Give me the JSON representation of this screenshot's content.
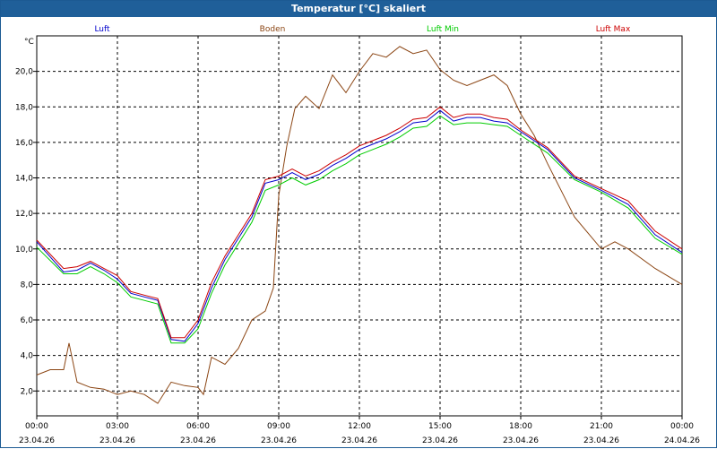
{
  "window": {
    "title": "Temperatur [°C] skaliert"
  },
  "chart_data": {
    "type": "line",
    "title": "Temperatur [°C] skaliert",
    "ylabel": "°C",
    "xlabel": "",
    "ylim": [
      0.6,
      22.0
    ],
    "xlim": [
      0,
      24
    ],
    "grid": true,
    "legend_position": "top",
    "y_ticks": [
      "2,0",
      "4,0",
      "6,0",
      "8,0",
      "10,0",
      "12,0",
      "14,0",
      "16,0",
      "18,0",
      "20,0"
    ],
    "y_tick_values": [
      2,
      4,
      6,
      8,
      10,
      12,
      14,
      16,
      18,
      20
    ],
    "x_ticks": [
      {
        "time": "00:00",
        "date": "23.04.26"
      },
      {
        "time": "03:00",
        "date": "23.04.26"
      },
      {
        "time": "06:00",
        "date": "23.04.26"
      },
      {
        "time": "09:00",
        "date": "23.04.26"
      },
      {
        "time": "12:00",
        "date": "23.04.26"
      },
      {
        "time": "15:00",
        "date": "23.04.26"
      },
      {
        "time": "18:00",
        "date": "23.04.26"
      },
      {
        "time": "21:00",
        "date": "23.04.26"
      },
      {
        "time": "00:00",
        "date": "24.04.26"
      }
    ],
    "series": [
      {
        "name": "Luft",
        "color": "#0000cc",
        "x": [
          0,
          1,
          1.5,
          2,
          2.5,
          3,
          3.5,
          4,
          4.5,
          5,
          5.5,
          6,
          6.5,
          7,
          7.5,
          8,
          8.5,
          9,
          9.5,
          10,
          10.5,
          11,
          11.5,
          12,
          12.5,
          13,
          13.5,
          14,
          14.5,
          15,
          15.5,
          16,
          16.5,
          17,
          17.5,
          18,
          19,
          20,
          21,
          22,
          23,
          24
        ],
        "y": [
          10.4,
          8.7,
          8.8,
          9.2,
          8.8,
          8.3,
          7.5,
          7.3,
          7.1,
          4.9,
          4.8,
          5.8,
          7.8,
          9.4,
          10.6,
          11.8,
          13.7,
          13.9,
          14.3,
          13.9,
          14.2,
          14.7,
          15.1,
          15.6,
          15.9,
          16.2,
          16.6,
          17.1,
          17.2,
          17.8,
          17.2,
          17.4,
          17.4,
          17.2,
          17.1,
          16.6,
          15.6,
          14.0,
          13.3,
          12.5,
          10.8,
          9.8
        ]
      },
      {
        "name": "Boden",
        "color": "#8b4513",
        "x": [
          0,
          0.5,
          1,
          1.2,
          1.5,
          2,
          2.5,
          3,
          3.5,
          4,
          4.5,
          5,
          5.5,
          6,
          6.2,
          6.5,
          7,
          7.5,
          8,
          8.5,
          8.8,
          9,
          9.3,
          9.6,
          10,
          10.5,
          11,
          11.5,
          12,
          12.5,
          13,
          13.5,
          14,
          14.5,
          15,
          15.5,
          16,
          16.5,
          17,
          17.5,
          18,
          18.5,
          19,
          20,
          21,
          21.5,
          22,
          23,
          24
        ],
        "y": [
          2.9,
          3.2,
          3.2,
          4.7,
          2.5,
          2.2,
          2.1,
          1.8,
          2.0,
          1.8,
          1.3,
          2.5,
          2.3,
          2.2,
          1.8,
          3.9,
          3.5,
          4.4,
          6.0,
          6.5,
          7.8,
          13.0,
          15.8,
          17.9,
          18.6,
          17.9,
          19.8,
          18.8,
          20.0,
          21.0,
          20.8,
          21.4,
          21.0,
          21.2,
          20.1,
          19.5,
          19.2,
          19.5,
          19.8,
          19.2,
          17.6,
          16.4,
          14.8,
          11.8,
          10.0,
          10.4,
          10.0,
          8.9,
          8.0
        ]
      },
      {
        "name": "Luft Min",
        "color": "#00cc00",
        "x": [
          0,
          1,
          1.5,
          2,
          2.5,
          3,
          3.5,
          4,
          4.5,
          5,
          5.5,
          6,
          6.5,
          7,
          7.5,
          8,
          8.5,
          9,
          9.5,
          10,
          10.5,
          11,
          11.5,
          12,
          12.5,
          13,
          13.5,
          14,
          14.5,
          15,
          15.5,
          16,
          16.5,
          17,
          17.5,
          18,
          19,
          20,
          21,
          22,
          23,
          24
        ],
        "y": [
          10.1,
          8.6,
          8.6,
          9.0,
          8.6,
          8.1,
          7.3,
          7.1,
          6.9,
          4.7,
          4.7,
          5.5,
          7.5,
          9.1,
          10.3,
          11.5,
          13.3,
          13.6,
          14.0,
          13.6,
          13.9,
          14.4,
          14.8,
          15.3,
          15.6,
          15.9,
          16.3,
          16.8,
          16.9,
          17.5,
          17.0,
          17.1,
          17.1,
          17.0,
          16.9,
          16.4,
          15.4,
          13.9,
          13.2,
          12.3,
          10.6,
          9.7
        ]
      },
      {
        "name": "Luft Max",
        "color": "#cc0000",
        "x": [
          0,
          1,
          1.5,
          2,
          2.5,
          3,
          3.5,
          4,
          4.5,
          5,
          5.5,
          6,
          6.5,
          7,
          7.5,
          8,
          8.5,
          9,
          9.5,
          10,
          10.5,
          11,
          11.5,
          12,
          12.5,
          13,
          13.5,
          14,
          14.5,
          15,
          15.5,
          16,
          16.5,
          17,
          17.5,
          18,
          19,
          20,
          21,
          22,
          23,
          24
        ],
        "y": [
          10.5,
          8.9,
          9.0,
          9.3,
          8.9,
          8.5,
          7.6,
          7.4,
          7.2,
          5.0,
          5.0,
          6.0,
          8.1,
          9.6,
          10.8,
          12.0,
          13.9,
          14.1,
          14.5,
          14.1,
          14.4,
          14.9,
          15.3,
          15.8,
          16.1,
          16.4,
          16.8,
          17.3,
          17.4,
          18.0,
          17.4,
          17.6,
          17.6,
          17.4,
          17.3,
          16.7,
          15.7,
          14.1,
          13.4,
          12.7,
          11.0,
          10.0
        ]
      }
    ]
  }
}
